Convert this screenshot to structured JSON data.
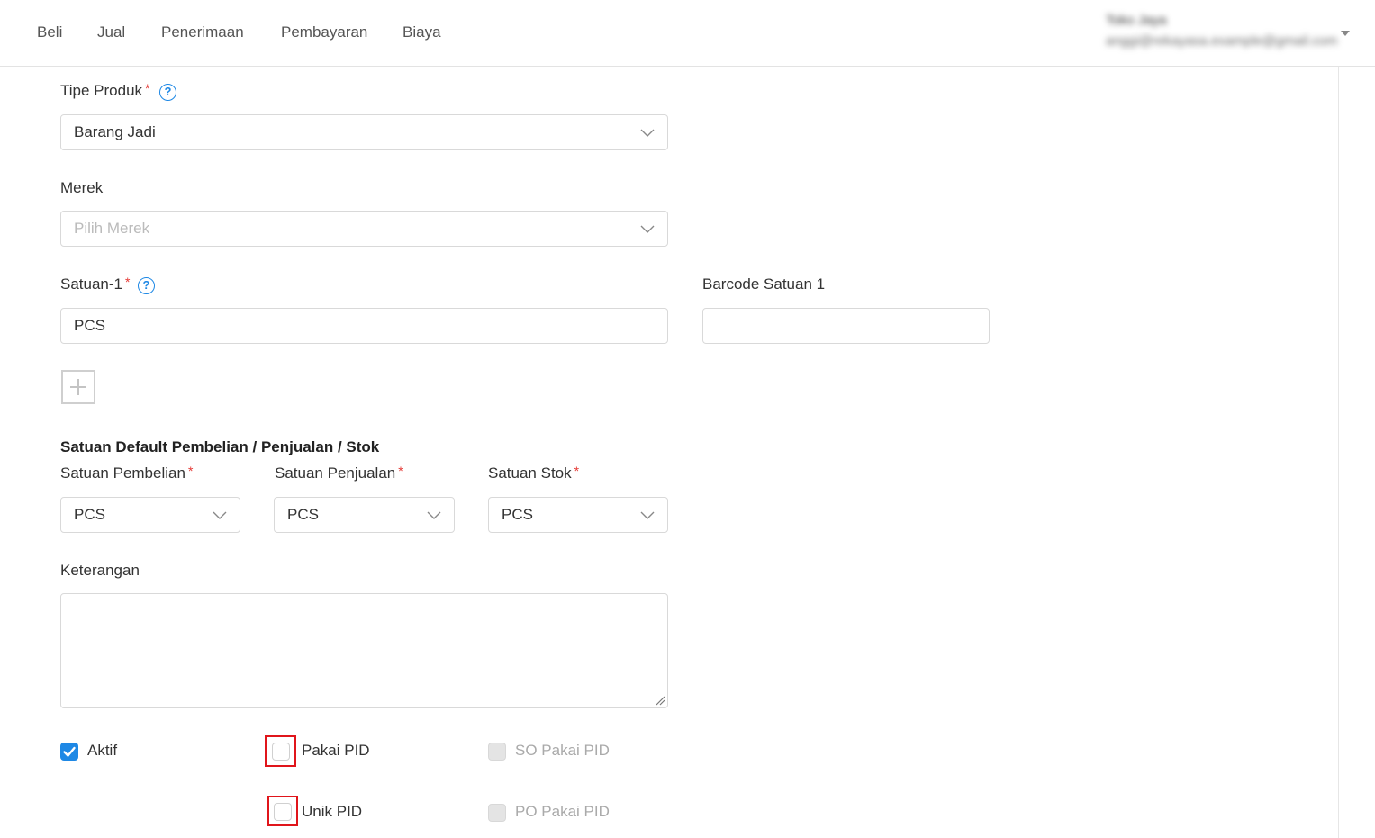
{
  "nav": {
    "items": [
      "Beli",
      "Jual",
      "Penerimaan",
      "Pembayaran",
      "Biaya"
    ]
  },
  "user": {
    "name": "Toko Jaya",
    "email": "anggi@rekayasa.example@gmail.com"
  },
  "form": {
    "tipe_produk": {
      "label": "Tipe Produk",
      "required": "*",
      "value": "Barang Jadi"
    },
    "merek": {
      "label": "Merek",
      "placeholder": "Pilih Merek"
    },
    "satuan1": {
      "label": "Satuan-1",
      "required": "*",
      "value": "PCS"
    },
    "barcode_satuan1": {
      "label": "Barcode Satuan 1",
      "value": ""
    },
    "default_section_title": "Satuan Default Pembelian / Penjualan / Stok",
    "satuan_pembelian": {
      "label": "Satuan Pembelian",
      "required": "*",
      "value": "PCS"
    },
    "satuan_penjualan": {
      "label": "Satuan Penjualan",
      "required": "*",
      "value": "PCS"
    },
    "satuan_stok": {
      "label": "Satuan Stok",
      "required": "*",
      "value": "PCS"
    },
    "keterangan": {
      "label": "Keterangan",
      "value": ""
    },
    "checkboxes": {
      "aktif": {
        "label": "Aktif",
        "checked": true
      },
      "pakai_pid": {
        "label": "Pakai PID",
        "checked": false
      },
      "so_pakai_pid": {
        "label": "SO Pakai PID",
        "disabled": true
      },
      "unik_pid": {
        "label": "Unik PID",
        "checked": false
      },
      "po_pakai_pid": {
        "label": "PO Pakai PID",
        "disabled": true
      }
    }
  },
  "icons": {
    "help": "question-circle-icon",
    "chevron": "chevron-down-icon",
    "add": "plus-icon",
    "check": "checkmark-icon"
  },
  "colors": {
    "accent": "#1e88e5",
    "required": "#e53935",
    "highlight": "#e0151b"
  }
}
